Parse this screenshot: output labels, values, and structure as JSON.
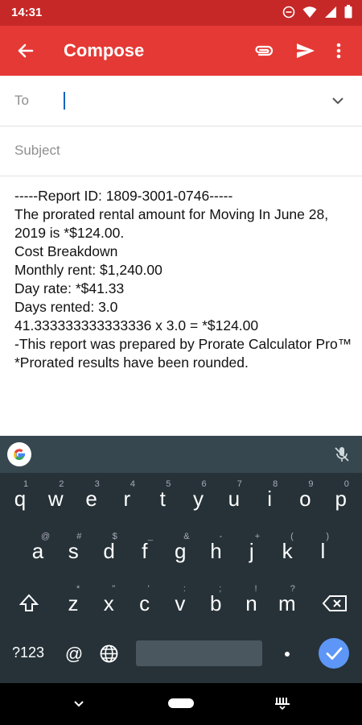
{
  "status_bar": {
    "time": "14:31"
  },
  "app_bar": {
    "title": "Compose"
  },
  "to_field": {
    "label": "To"
  },
  "subject_field": {
    "placeholder": "Subject"
  },
  "body_lines": [
    "-----Report ID: 1809-3001-0746-----",
    "The prorated rental amount for Moving In June 28, 2019 is *$124.00.",
    "",
    "Cost Breakdown",
    "Monthly rent: $1,240.00",
    "Day rate: *$41.33",
    "Days rented: 3.0",
    "",
    "41.333333333333336 x 3.0 = *$124.00",
    "-This report was prepared by Prorate Calculator Pro™",
    "*Prorated results have been rounded."
  ],
  "keyboard": {
    "row1": [
      {
        "k": "q",
        "s": "1"
      },
      {
        "k": "w",
        "s": "2"
      },
      {
        "k": "e",
        "s": "3"
      },
      {
        "k": "r",
        "s": "4"
      },
      {
        "k": "t",
        "s": "5"
      },
      {
        "k": "y",
        "s": "6"
      },
      {
        "k": "u",
        "s": "7"
      },
      {
        "k": "i",
        "s": "8"
      },
      {
        "k": "o",
        "s": "9"
      },
      {
        "k": "p",
        "s": "0"
      }
    ],
    "row2": [
      {
        "k": "a",
        "s": "@"
      },
      {
        "k": "s",
        "s": "#"
      },
      {
        "k": "d",
        "s": "$"
      },
      {
        "k": "f",
        "s": "_"
      },
      {
        "k": "g",
        "s": "&"
      },
      {
        "k": "h",
        "s": "-"
      },
      {
        "k": "j",
        "s": "+"
      },
      {
        "k": "k",
        "s": "("
      },
      {
        "k": "l",
        "s": ")"
      }
    ],
    "row3": [
      {
        "k": "z",
        "s": "*"
      },
      {
        "k": "x",
        "s": "\""
      },
      {
        "k": "c",
        "s": "'"
      },
      {
        "k": "v",
        "s": ":"
      },
      {
        "k": "b",
        "s": ";"
      },
      {
        "k": "n",
        "s": "!"
      },
      {
        "k": "m",
        "s": "?"
      }
    ],
    "sym_label": "?123",
    "at_label": "@"
  },
  "colors": {
    "status_bar": "#c62828",
    "app_bar": "#e53935",
    "keyboard_bg": "#263238",
    "enter_key": "#5d96f6"
  }
}
